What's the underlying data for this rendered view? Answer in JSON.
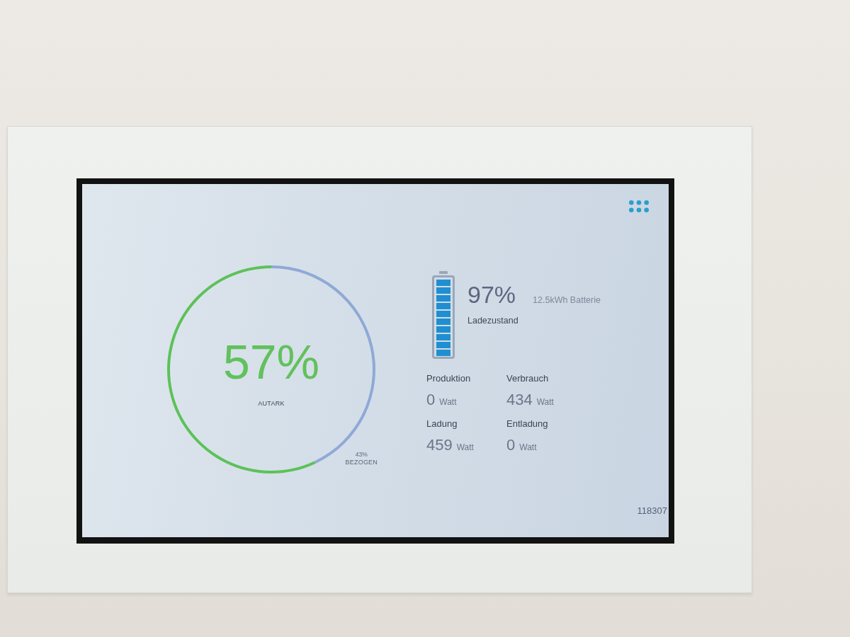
{
  "autarky": {
    "percent": "57%",
    "grid_percent": "43%",
    "chart_data": {
      "type": "donut",
      "categories": [
        "AUTARK",
        "BEZOGEN"
      ],
      "values": [
        57,
        43
      ]
    }
  },
  "battery": {
    "level": 0.97,
    "percent": "97%",
    "capacity": "12.5kWh Batterie",
    "label": "Ladezustand"
  },
  "stats": [
    {
      "label": "Produktion",
      "value": "0",
      "unit": "Watt"
    },
    {
      "label": "Verbrauch",
      "value": "434",
      "unit": "Watt"
    },
    {
      "label": "Ladung",
      "value": "459",
      "unit": "Watt"
    },
    {
      "label": "Entladung",
      "value": "0",
      "unit": "Watt"
    }
  ],
  "serial": "118307"
}
